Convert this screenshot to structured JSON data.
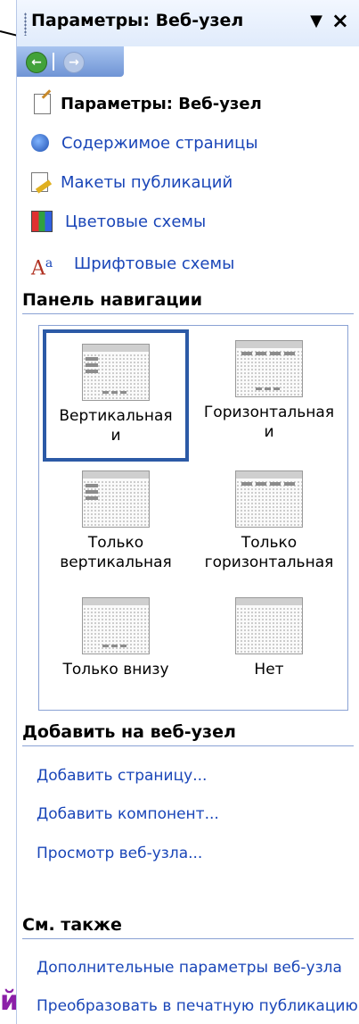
{
  "taskpane": {
    "title": "Параметры: Веб-узел",
    "tasks": [
      {
        "label": "Параметры: Веб-узел",
        "icon": "page-edit-icon"
      },
      {
        "label": "Содержимое страницы",
        "icon": "page-content-icon"
      },
      {
        "label": "Макеты публикаций",
        "icon": "layout-edit-icon"
      },
      {
        "label": "Цветовые схемы",
        "icon": "color-grid-icon"
      },
      {
        "label": "Шрифтовые схемы",
        "icon": "font-scheme-icon"
      }
    ]
  },
  "nav_panel": {
    "heading": "Панель навигации",
    "options": [
      {
        "line1": "Вертикальная",
        "line2": "и",
        "selected": true
      },
      {
        "line1": "Горизонтальная",
        "line2": "и",
        "selected": false
      },
      {
        "line1": "Только",
        "line2": "вертикальная",
        "selected": false
      },
      {
        "line1": "Только",
        "line2": "горизонтальная",
        "selected": false
      },
      {
        "line1": "Только внизу",
        "line2": "",
        "selected": false
      },
      {
        "line1": "Нет",
        "line2": "",
        "selected": false
      }
    ]
  },
  "add_section": {
    "heading": "Добавить на веб-узел",
    "links": [
      "Добавить страницу...",
      "Добавить компонент...",
      "Просмотр веб-узла..."
    ]
  },
  "see_also": {
    "heading": "См. также",
    "links": [
      "Дополнительные параметры веб-узла",
      "Преобразовать в печатную публикацию"
    ]
  },
  "overlay": {
    "purple_fragment": "й"
  },
  "colors": {
    "link": "#1a46b8",
    "selection": "#2c5aa6",
    "panel_border": "#8aa2d4",
    "purple_text": "#8b1fa8"
  }
}
